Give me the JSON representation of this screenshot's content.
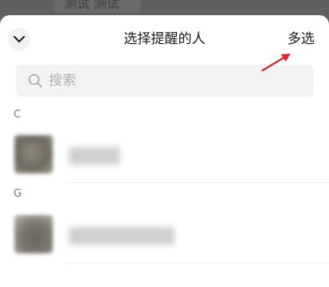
{
  "background": {
    "chip_text": "测试 测试"
  },
  "header": {
    "title": "选择提醒的人",
    "multi_select_label": "多选",
    "collapse_icon": "chevron-down-icon"
  },
  "search": {
    "placeholder": "搜索",
    "icon": "search-icon"
  },
  "sections": [
    {
      "letter": "C"
    },
    {
      "letter": "G"
    }
  ],
  "colors": {
    "annotation_arrow": "#e0262b",
    "sheet_bg": "#ffffff",
    "backdrop": "#606060"
  }
}
